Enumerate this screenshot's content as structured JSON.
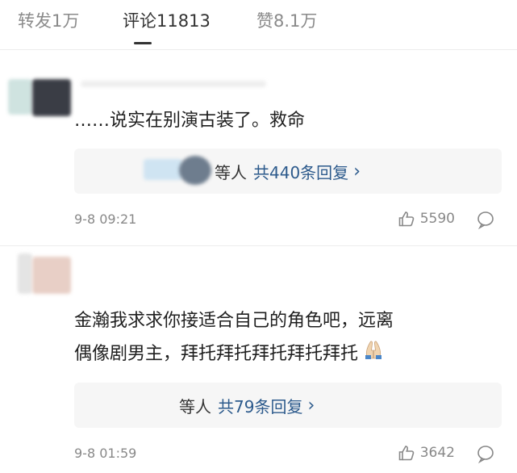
{
  "tabs": {
    "repost": "转发1万",
    "comments": "评论11813",
    "likes": "赞8.1万"
  },
  "comments": [
    {
      "text": "……说实在别演古装了。救命",
      "replies": {
        "prefix": "等人",
        "count": "共440条回复"
      },
      "time": "9-8 09:21",
      "likes": "5590"
    },
    {
      "text_lines": [
        "金瀚我求求你接适合自己的角色吧，远离",
        "偶像剧男主，拜托拜托拜托拜托拜托"
      ],
      "replies": {
        "prefix": "等人",
        "count": "共79条回复"
      },
      "time": "9-8 01:59",
      "likes": "3642"
    }
  ],
  "icons": {
    "like": "thumbs-up-icon",
    "comment": "speech-bubble-icon",
    "chevron": "chevron-right-icon",
    "hands": "folded-hands-emoji"
  },
  "colors": {
    "reply_link": "#2c5a8c",
    "muted": "#888888"
  }
}
